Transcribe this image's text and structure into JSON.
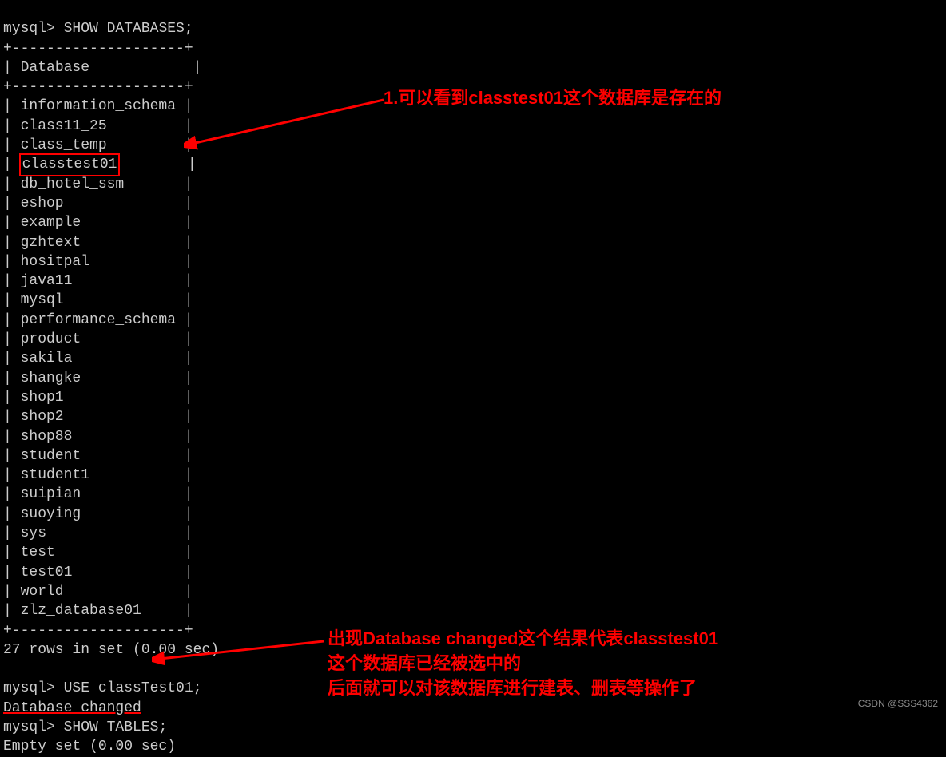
{
  "prompt_prefix": "mysql> ",
  "commands": {
    "show_db": "SHOW DATABASES;",
    "use_db": "USE classTest01;",
    "show_tables": "SHOW TABLES;"
  },
  "table_header": "Database",
  "databases": [
    "information_schema",
    "class11_25",
    "class_temp",
    "classtest01",
    "db_hotel_ssm",
    "eshop",
    "example",
    "gzhtext",
    "hositpal",
    "java11",
    "mysql",
    "performance_schema",
    "product",
    "sakila",
    "shangke",
    "shop1",
    "shop2",
    "shop88",
    "student",
    "student1",
    "suipian",
    "suoying",
    "sys",
    "test",
    "test01",
    "world",
    "zlz_database01"
  ],
  "highlight_db": "classtest01",
  "row_count_msg": "27 rows in set (0.00 sec)",
  "db_changed_msg": "Database changed",
  "empty_set_msg": "Empty set (0.00 sec)",
  "border_line": "+--------------------+",
  "pipe": "| ",
  "pipe_end": " |",
  "annotations": {
    "top": "1.可以看到classtest01这个数据库是存在的",
    "bottom_line1": "出现Database changed这个结果代表classtest01",
    "bottom_line2": "这个数据库已经被选中的",
    "bottom_line3": "后面就可以对该数据库进行建表、删表等操作了"
  },
  "watermark": "CSDN @SSS4362"
}
